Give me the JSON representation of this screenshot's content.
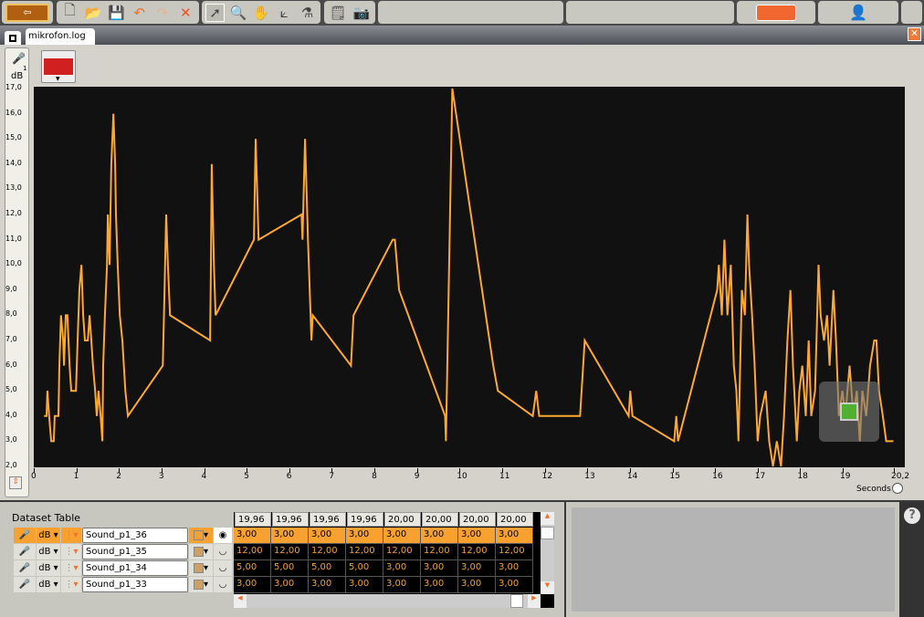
{
  "tab": {
    "title": "mikrofon.log"
  },
  "toolbar": {
    "buttons": [
      "upload-download",
      "new",
      "open",
      "save",
      "undo",
      "redo",
      "delete",
      "pointer",
      "zoom",
      "pan",
      "axis-tool",
      "analysis-tool",
      "notes",
      "snapshot"
    ]
  },
  "sidebar": {
    "unit": "dB",
    "sensor_index": "1"
  },
  "axis": {
    "x_label": "Seconds",
    "x_ticks": [
      "0",
      "1",
      "2",
      "3",
      "4",
      "5",
      "6",
      "7",
      "8",
      "9",
      "10",
      "11",
      "12",
      "13",
      "14",
      "15",
      "16",
      "17",
      "18",
      "19",
      "20,2"
    ],
    "y_ticks": [
      "17,0",
      "16,0",
      "15,0",
      "14,0",
      "13,0",
      "12,0",
      "11,0",
      "10,0",
      "9,0",
      "8,0",
      "7,0",
      "6,0",
      "5,0",
      "4,0",
      "3,0",
      "2,0"
    ]
  },
  "dataset_table": {
    "title": "Dataset Table",
    "rows": [
      {
        "unit": "dB",
        "name": "Sound_p1_36",
        "selected": true
      },
      {
        "unit": "dB",
        "name": "Sound_p1_35",
        "selected": false
      },
      {
        "unit": "dB",
        "name": "Sound_p1_34",
        "selected": false
      },
      {
        "unit": "dB",
        "name": "Sound_p1_33",
        "selected": false
      }
    ],
    "columns": [
      "19,96",
      "19,96",
      "19,96",
      "19,96",
      "20,00",
      "20,00",
      "20,00",
      "20,00"
    ],
    "values": [
      [
        "3,00",
        "3,00",
        "3,00",
        "3,00",
        "3,00",
        "3,00",
        "3,00",
        "3,00"
      ],
      [
        "12,00",
        "12,00",
        "12,00",
        "12,00",
        "12,00",
        "12,00",
        "12,00",
        "12,00"
      ],
      [
        "5,00",
        "5,00",
        "5,00",
        "5,00",
        "3,00",
        "3,00",
        "3,00",
        "3,00"
      ],
      [
        "3,00",
        "3,00",
        "3,00",
        "3,00",
        "3,00",
        "3,00",
        "3,00",
        "3,00"
      ]
    ]
  },
  "colors": {
    "series": "#ffa830",
    "plot_bg": "#111111",
    "accent": "#f07030"
  },
  "chart_data": {
    "type": "line",
    "xlabel": "Seconds",
    "ylabel": "dB",
    "xlim": [
      0,
      20.2
    ],
    "ylim": [
      2,
      17
    ],
    "grid": false,
    "series": [
      {
        "name": "Sound_p1_36",
        "points": [
          [
            0.24,
            4
          ],
          [
            0.3,
            4
          ],
          [
            0.32,
            5
          ],
          [
            0.36,
            4
          ],
          [
            0.41,
            3
          ],
          [
            0.47,
            3
          ],
          [
            0.49,
            4
          ],
          [
            0.58,
            4
          ],
          [
            0.6,
            6
          ],
          [
            0.64,
            8
          ],
          [
            0.69,
            7
          ],
          [
            0.71,
            6
          ],
          [
            0.75,
            8
          ],
          [
            0.79,
            8
          ],
          [
            0.84,
            6
          ],
          [
            0.88,
            5
          ],
          [
            0.92,
            5
          ],
          [
            0.99,
            5
          ],
          [
            1.03,
            7
          ],
          [
            1.07,
            9
          ],
          [
            1.12,
            10
          ],
          [
            1.16,
            8
          ],
          [
            1.2,
            7
          ],
          [
            1.27,
            7
          ],
          [
            1.31,
            8
          ],
          [
            1.35,
            7
          ],
          [
            1.39,
            6
          ],
          [
            1.44,
            5
          ],
          [
            1.48,
            4
          ],
          [
            1.52,
            5
          ],
          [
            1.57,
            4
          ],
          [
            1.61,
            3
          ],
          [
            1.63,
            6
          ],
          [
            1.67,
            8
          ],
          [
            1.72,
            10
          ],
          [
            1.74,
            12
          ],
          [
            1.78,
            10
          ],
          [
            1.82,
            14
          ],
          [
            1.87,
            16
          ],
          [
            1.91,
            14
          ],
          [
            1.93,
            12
          ],
          [
            1.97,
            10
          ],
          [
            2.02,
            8
          ],
          [
            2.08,
            7
          ],
          [
            2.15,
            5
          ],
          [
            2.21,
            4
          ],
          [
            3.03,
            6
          ],
          [
            3.07,
            9
          ],
          [
            3.11,
            12
          ],
          [
            3.15,
            10
          ],
          [
            3.2,
            8
          ],
          [
            4.14,
            7
          ],
          [
            4.16,
            10
          ],
          [
            4.18,
            14
          ],
          [
            4.23,
            10
          ],
          [
            4.27,
            8
          ],
          [
            5.17,
            11
          ],
          [
            5.21,
            15
          ],
          [
            5.28,
            11
          ],
          [
            6.29,
            12
          ],
          [
            6.31,
            11
          ],
          [
            6.37,
            15
          ],
          [
            6.44,
            11
          ],
          [
            6.48,
            9
          ],
          [
            6.52,
            7
          ],
          [
            6.55,
            8
          ],
          [
            7.45,
            6
          ],
          [
            7.51,
            8
          ],
          [
            8.43,
            11
          ],
          [
            8.48,
            11
          ],
          [
            8.58,
            9
          ],
          [
            9.66,
            4
          ],
          [
            9.68,
            3
          ],
          [
            9.83,
            17
          ],
          [
            10.79,
            6
          ],
          [
            10.9,
            5
          ],
          [
            11.72,
            4
          ],
          [
            11.8,
            5
          ],
          [
            11.87,
            4
          ],
          [
            12.83,
            4
          ],
          [
            12.94,
            7
          ],
          [
            13.97,
            4
          ],
          [
            14.01,
            5
          ],
          [
            14.06,
            4
          ],
          [
            15.04,
            3
          ],
          [
            15.09,
            4
          ],
          [
            15.13,
            3
          ],
          [
            16.05,
            9
          ],
          [
            16.09,
            10
          ],
          [
            16.16,
            8
          ],
          [
            16.22,
            11
          ],
          [
            16.29,
            8
          ],
          [
            16.37,
            10
          ],
          [
            16.44,
            6
          ],
          [
            16.5,
            5
          ],
          [
            16.55,
            3
          ],
          [
            16.63,
            9
          ],
          [
            16.7,
            8
          ],
          [
            16.76,
            12
          ],
          [
            16.8,
            10
          ],
          [
            16.87,
            8
          ],
          [
            16.93,
            6
          ],
          [
            17.0,
            3
          ],
          [
            17.06,
            4
          ],
          [
            17.19,
            5
          ],
          [
            17.27,
            3
          ],
          [
            17.36,
            2
          ],
          [
            17.45,
            3
          ],
          [
            17.55,
            2
          ],
          [
            17.62,
            4
          ],
          [
            17.7,
            7
          ],
          [
            17.77,
            9
          ],
          [
            17.83,
            6
          ],
          [
            17.92,
            3
          ],
          [
            17.98,
            5
          ],
          [
            18.05,
            6
          ],
          [
            18.13,
            4
          ],
          [
            18.2,
            7
          ],
          [
            18.26,
            4
          ],
          [
            18.35,
            5
          ],
          [
            18.43,
            10
          ],
          [
            18.48,
            8
          ],
          [
            18.56,
            7
          ],
          [
            18.63,
            8
          ],
          [
            18.69,
            6
          ],
          [
            18.78,
            9
          ],
          [
            18.84,
            7
          ],
          [
            18.91,
            4
          ],
          [
            18.99,
            5
          ],
          [
            19.06,
            4
          ],
          [
            19.16,
            6
          ],
          [
            19.25,
            4
          ],
          [
            19.33,
            5
          ],
          [
            19.4,
            3
          ],
          [
            19.46,
            5
          ],
          [
            19.55,
            4
          ],
          [
            19.64,
            6
          ],
          [
            19.74,
            7
          ],
          [
            19.79,
            7
          ],
          [
            19.85,
            5
          ],
          [
            19.94,
            4
          ],
          [
            20.02,
            3
          ],
          [
            20.19,
            3
          ]
        ]
      }
    ]
  }
}
